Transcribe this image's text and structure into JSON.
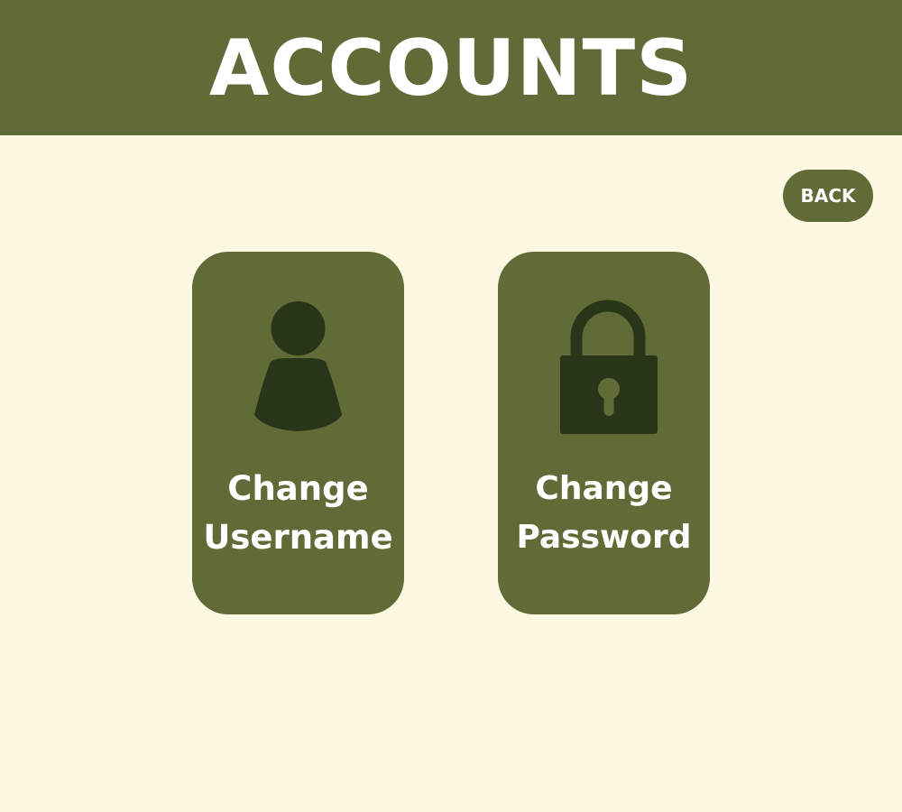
{
  "header": {
    "title": "ACCOUNTS"
  },
  "toolbar": {
    "back_label": "BACK"
  },
  "cards": [
    {
      "id": "change-username",
      "icon": "user-icon",
      "label_line1": "Change",
      "label_line2": "Username"
    },
    {
      "id": "change-password",
      "icon": "lock-icon",
      "label_line1": "Change",
      "label_line2": "Password"
    }
  ],
  "colors": {
    "background": "#fdf8e1",
    "primary": "#616b38",
    "icon_dark": "#283518",
    "text_light": "#ffffff"
  }
}
